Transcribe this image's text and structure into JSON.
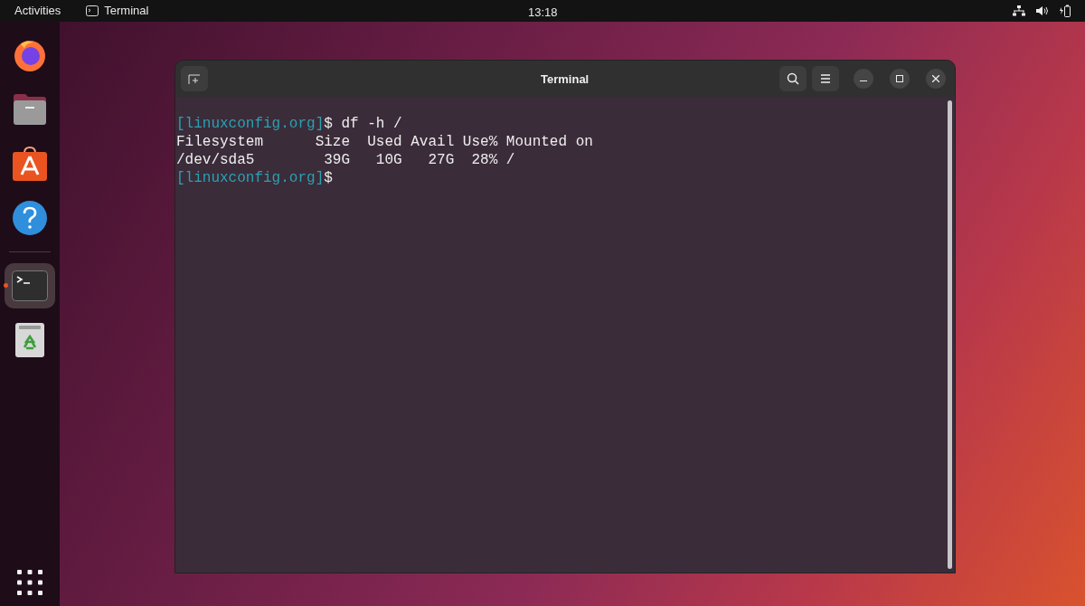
{
  "top_bar": {
    "activities": "Activities",
    "app_name": "Terminal",
    "clock": "13:18"
  },
  "dock": {
    "items": [
      {
        "kind": "firefox",
        "running": false,
        "selected": false
      },
      {
        "kind": "files",
        "running": false,
        "selected": false
      },
      {
        "kind": "software",
        "running": false,
        "selected": false
      },
      {
        "kind": "help",
        "running": false,
        "selected": false
      },
      {
        "kind": "terminal",
        "running": true,
        "selected": true
      },
      {
        "kind": "trash",
        "running": false,
        "selected": false
      }
    ]
  },
  "window": {
    "title": "Terminal"
  },
  "terminal": {
    "lines": [
      {
        "prompt": "[linuxconfig.org]",
        "text": "$ df -h /"
      },
      {
        "text": "Filesystem      Size  Used Avail Use% Mounted on"
      },
      {
        "text": "/dev/sda5        39G   10G   27G  28% /"
      },
      {
        "prompt": "[linuxconfig.org]",
        "text": "$"
      }
    ]
  }
}
